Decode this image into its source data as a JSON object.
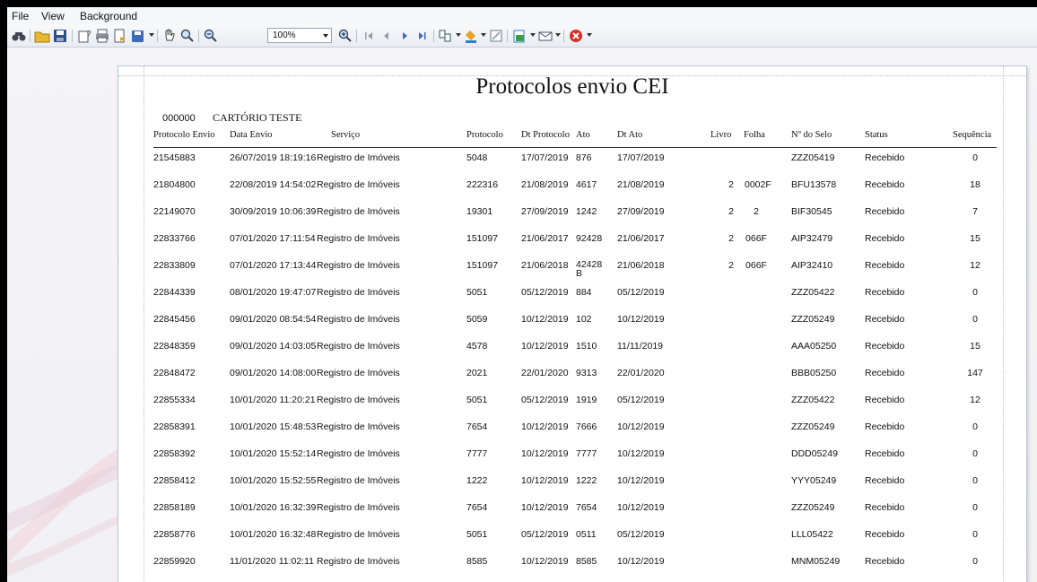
{
  "menu": [
    "File",
    "View",
    "Background"
  ],
  "toolbar": {
    "zoom": "100%"
  },
  "report": {
    "title": "Protocolos envio CEI",
    "code": "000000",
    "office": "CARTÓRIO TESTE",
    "columns": [
      "Protocolo Envio",
      "Data Envio",
      "Serviço",
      "Protocolo",
      "Dt Protocolo",
      "Ato",
      "Dt Ato",
      "Livro",
      "Folha",
      "Nº do Selo",
      "Status",
      "Sequência"
    ],
    "rows": [
      [
        "21545883",
        "26/07/2019 18:19:16",
        "Registro de Imóveis",
        "5048",
        "17/07/2019",
        "876",
        "17/07/2019",
        "",
        "",
        "ZZZ05419",
        "Recebido",
        "0"
      ],
      [
        "21804800",
        "22/08/2019 14:54:02",
        "Registro de Imóveis",
        "222316",
        "21/08/2019",
        "4617",
        "21/08/2019",
        "2",
        "0002F",
        "BFU13578",
        "Recebido",
        "18"
      ],
      [
        "22149070",
        "30/09/2019 10:06:39",
        "Registro de Imóveis",
        "19301",
        "27/09/2019",
        "1242",
        "27/09/2019",
        "2",
        "2",
        "BIF30545",
        "Recebido",
        "7"
      ],
      [
        "22833766",
        "07/01/2020 17:11:54",
        "Registro de Imóveis",
        "151097",
        "21/06/2017",
        "92428",
        "21/06/2017",
        "2",
        "066F",
        "AIP32479",
        "Recebido",
        "15"
      ],
      [
        "22833809",
        "07/01/2020 17:13:44",
        "Registro de Imóveis",
        "151097",
        "21/06/2018",
        "42428 B",
        "21/06/2018",
        "2",
        "066F",
        "AIP32410",
        "Recebido",
        "12"
      ],
      [
        "22844339",
        "08/01/2020 19:47:07",
        "Registro de Imóveis",
        "5051",
        "05/12/2019",
        "884",
        "05/12/2019",
        "",
        "",
        "ZZZ05422",
        "Recebido",
        "0"
      ],
      [
        "22845456",
        "09/01/2020 08:54:54",
        "Registro de Imóveis",
        "5059",
        "10/12/2019",
        "102",
        "10/12/2019",
        "",
        "",
        "ZZZ05249",
        "Recebido",
        "0"
      ],
      [
        "22848359",
        "09/01/2020 14:03:05",
        "Registro de Imóveis",
        "4578",
        "10/12/2019",
        "1510",
        "11/11/2019",
        "",
        "",
        "AAA05250",
        "Recebido",
        "15"
      ],
      [
        "22848472",
        "09/01/2020 14:08:00",
        "Registro de Imóveis",
        "2021",
        "22/01/2020",
        "9313",
        "22/01/2020",
        "",
        "",
        "BBB05250",
        "Recebido",
        "147"
      ],
      [
        "22855334",
        "10/01/2020 11:20:21",
        "Registro de Imóveis",
        "5051",
        "05/12/2019",
        "1919",
        "05/12/2019",
        "",
        "",
        "ZZZ05422",
        "Recebido",
        "12"
      ],
      [
        "22858391",
        "10/01/2020 15:48:53",
        "Registro de Imóveis",
        "7654",
        "10/12/2019",
        "7666",
        "10/12/2019",
        "",
        "",
        "ZZZ05249",
        "Recebido",
        "0"
      ],
      [
        "22858392",
        "10/01/2020 15:52:14",
        "Registro de Imóveis",
        "7777",
        "10/12/2019",
        "7777",
        "10/12/2019",
        "",
        "",
        "DDD05249",
        "Recebido",
        "0"
      ],
      [
        "22858412",
        "10/01/2020 15:52:55",
        "Registro de Imóveis",
        "1222",
        "10/12/2019",
        "1222",
        "10/12/2019",
        "",
        "",
        "YYY05249",
        "Recebido",
        "0"
      ],
      [
        "22858189",
        "10/01/2020 16:32:39",
        "Registro de Imóveis",
        "7654",
        "10/12/2019",
        "7654",
        "10/12/2019",
        "",
        "",
        "ZZZ05249",
        "Recebido",
        "0"
      ],
      [
        "22858776",
        "10/01/2020 16:32:48",
        "Registro de Imóveis",
        "5051",
        "05/12/2019",
        "0511",
        "05/12/2019",
        "",
        "",
        "LLL05422",
        "Recebido",
        "0"
      ],
      [
        "22859920",
        "11/01/2020 11:02:11",
        "Registro de Imóveis",
        "8585",
        "10/12/2019",
        "8585",
        "10/12/2019",
        "",
        "",
        "MNM05249",
        "Recebido",
        "0"
      ]
    ]
  }
}
